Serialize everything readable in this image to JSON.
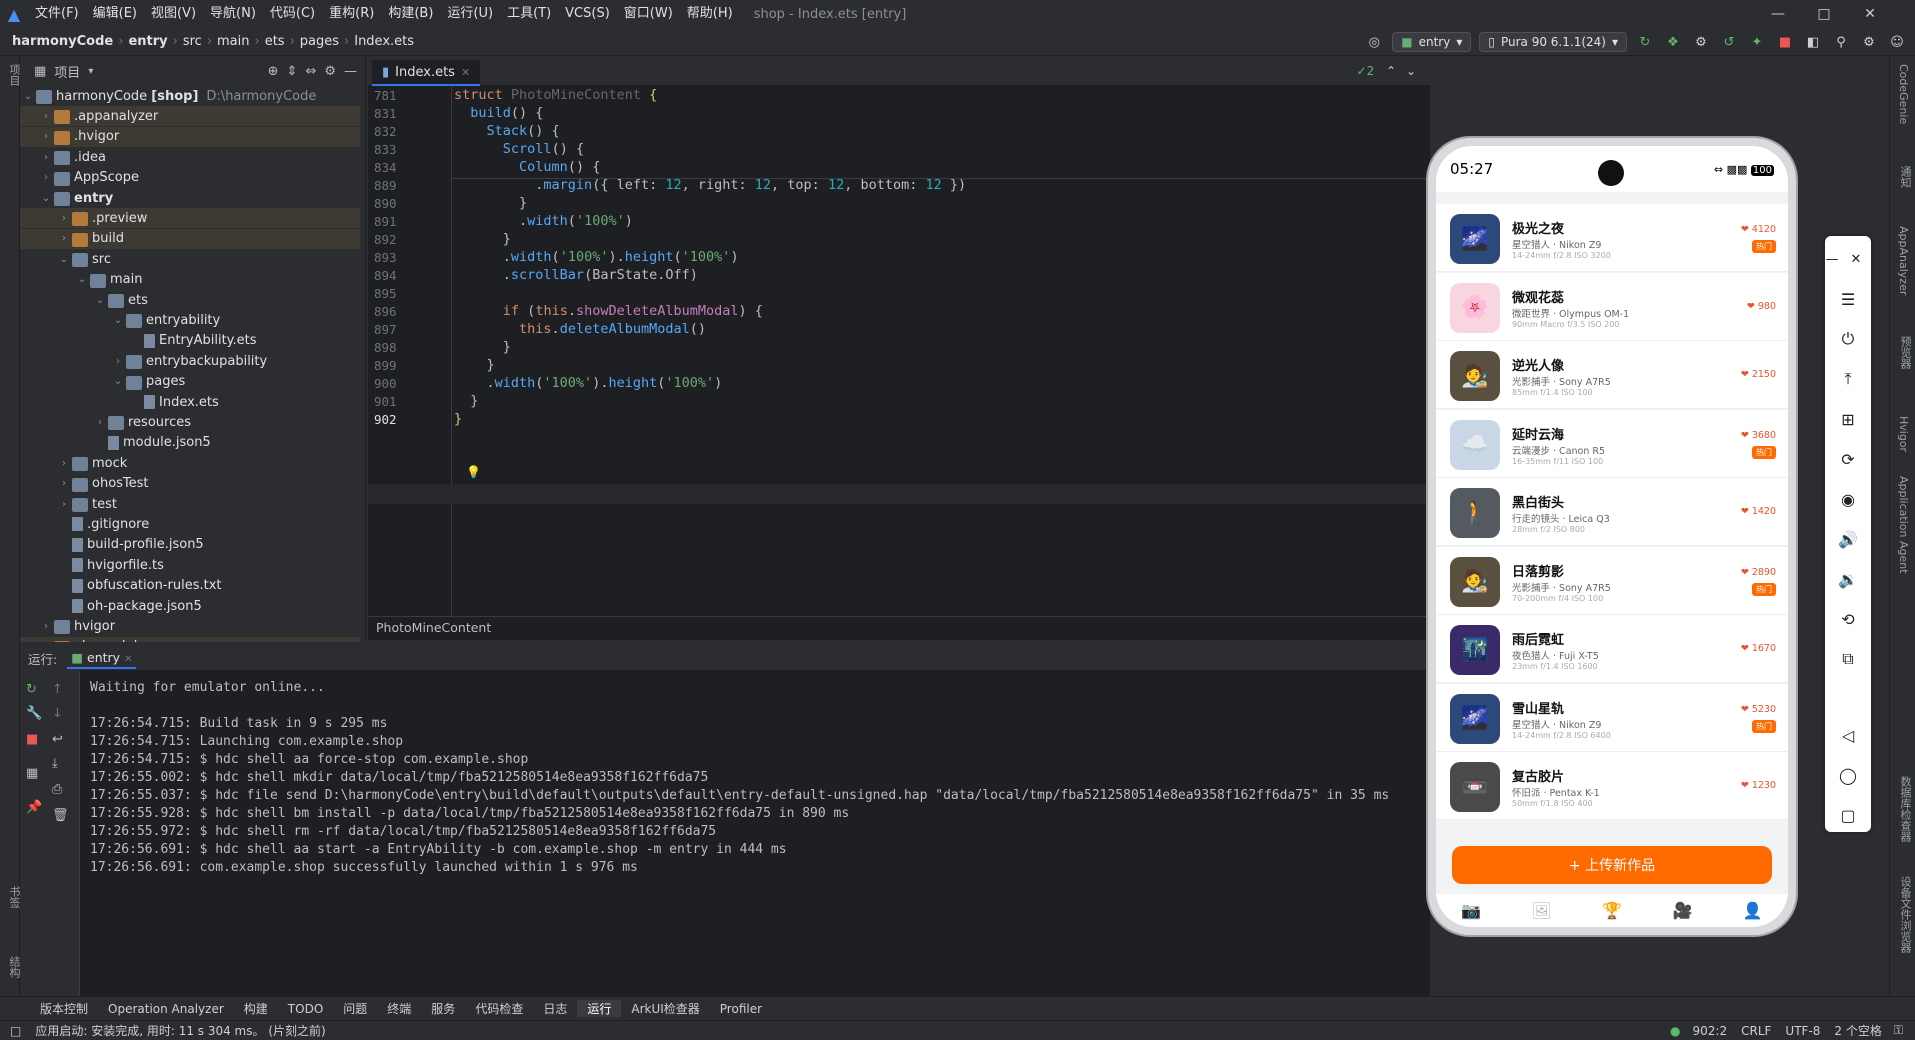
{
  "window": {
    "menu": [
      "文件(F)",
      "编辑(E)",
      "视图(V)",
      "导航(N)",
      "代码(C)",
      "重构(R)",
      "构建(B)",
      "运行(U)",
      "工具(T)",
      "VCS(S)",
      "窗口(W)",
      "帮助(H)"
    ],
    "title": "shop - Index.ets [entry]"
  },
  "navbar": {
    "crumbs": [
      "harmonyCode",
      "entry",
      "src",
      "main",
      "ets",
      "pages",
      "Index.ets"
    ],
    "run_config": "entry",
    "device": "Pura 90 6.1.1(24)"
  },
  "project": {
    "panel_title": "项目",
    "root_name": "harmonyCode",
    "root_module": "[shop]",
    "root_path": "D:\\harmonyCode",
    "tree": [
      {
        "name": ".appanalyzer",
        "depth": 1,
        "type": "folder-orange",
        "expanded": false,
        "hl": true
      },
      {
        "name": ".hvigor",
        "depth": 1,
        "type": "folder-orange",
        "expanded": false,
        "hl": true
      },
      {
        "name": ".idea",
        "depth": 1,
        "type": "folder",
        "expanded": false
      },
      {
        "name": "AppScope",
        "depth": 1,
        "type": "folder",
        "expanded": false
      },
      {
        "name": "entry",
        "depth": 1,
        "type": "folder",
        "expanded": true,
        "bold": true
      },
      {
        "name": ".preview",
        "depth": 2,
        "type": "folder-orange",
        "expanded": false,
        "hl": true
      },
      {
        "name": "build",
        "depth": 2,
        "type": "folder-orange",
        "expanded": false,
        "hl": true
      },
      {
        "name": "src",
        "depth": 2,
        "type": "folder",
        "expanded": true
      },
      {
        "name": "main",
        "depth": 3,
        "type": "folder",
        "expanded": true
      },
      {
        "name": "ets",
        "depth": 4,
        "type": "folder",
        "expanded": true
      },
      {
        "name": "entryability",
        "depth": 5,
        "type": "folder",
        "expanded": true
      },
      {
        "name": "EntryAbility.ets",
        "depth": 6,
        "type": "file"
      },
      {
        "name": "entrybackupability",
        "depth": 5,
        "type": "folder",
        "expanded": false
      },
      {
        "name": "pages",
        "depth": 5,
        "type": "folder",
        "expanded": true
      },
      {
        "name": "Index.ets",
        "depth": 6,
        "type": "file"
      },
      {
        "name": "resources",
        "depth": 4,
        "type": "folder",
        "expanded": false
      },
      {
        "name": "module.json5",
        "depth": 4,
        "type": "file"
      },
      {
        "name": "mock",
        "depth": 2,
        "type": "folder",
        "expanded": false
      },
      {
        "name": "ohosTest",
        "depth": 2,
        "type": "folder",
        "expanded": false
      },
      {
        "name": "test",
        "depth": 2,
        "type": "folder",
        "expanded": false
      },
      {
        "name": ".gitignore",
        "depth": 2,
        "type": "file"
      },
      {
        "name": "build-profile.json5",
        "depth": 2,
        "type": "file"
      },
      {
        "name": "hvigorfile.ts",
        "depth": 2,
        "type": "file"
      },
      {
        "name": "obfuscation-rules.txt",
        "depth": 2,
        "type": "file"
      },
      {
        "name": "oh-package.json5",
        "depth": 2,
        "type": "file"
      },
      {
        "name": "hvigor",
        "depth": 1,
        "type": "folder",
        "expanded": false
      },
      {
        "name": "oh_modules",
        "depth": 1,
        "type": "folder-orange",
        "expanded": false,
        "hl": true
      }
    ]
  },
  "editor": {
    "tab": "Index.ets",
    "breadcrumb": "PhotoMineContent",
    "problems": "2",
    "lines": [
      {
        "n": "781",
        "html": "<span class='kw'>struct</span> <span style='color:#bcbec4;opacity:.45'>PhotoMineContent</span> <span style='color:#e0c46c'>{</span>"
      },
      {
        "n": "831",
        "html": "  <span class='fn'>build</span>() {"
      },
      {
        "n": "832",
        "html": "    <span class='fn'>Stack</span>() {"
      },
      {
        "n": "833",
        "html": "      <span class='fn'>Scroll</span>() {"
      },
      {
        "n": "834",
        "html": "        <span class='fn'>Column</span>() {"
      },
      {
        "n": "889",
        "html": "          .<span class='fn'>margin</span>({ left: <span class='num'>12</span>, right: <span class='num'>12</span>, top: <span class='num'>12</span>, bottom: <span class='num'>12</span> })"
      },
      {
        "n": "890",
        "html": "        }"
      },
      {
        "n": "891",
        "html": "        .<span class='fn'>width</span>(<span class='str'>'100%'</span>)"
      },
      {
        "n": "892",
        "html": "      }"
      },
      {
        "n": "893",
        "html": "      .<span class='fn'>width</span>(<span class='str'>'100%'</span>).<span class='fn'>height</span>(<span class='str'>'100%'</span>)"
      },
      {
        "n": "894",
        "html": "      .<span class='fn'>scrollBar</span>(BarState.Off)"
      },
      {
        "n": "895",
        "html": ""
      },
      {
        "n": "896",
        "html": "      <span class='kw'>if</span> (<span class='kw'>this</span>.<span class='mem'>showDeleteAlbumModal</span>) {"
      },
      {
        "n": "897",
        "html": "        <span class='kw'>this</span>.<span class='fn'>deleteAlbumModal</span>()"
      },
      {
        "n": "898",
        "html": "      }"
      },
      {
        "n": "899",
        "html": "    }"
      },
      {
        "n": "900",
        "html": "    .<span class='fn'>width</span>(<span class='str'>'100%'</span>).<span class='fn'>height</span>(<span class='str'>'100%'</span>)"
      },
      {
        "n": "901",
        "html": "  }"
      },
      {
        "n": "902",
        "html": "<span style='color:#e0c46c'>}</span>"
      }
    ]
  },
  "run": {
    "label": "运行:",
    "tab": "entry",
    "lines": [
      "Waiting for emulator online...",
      "",
      "17:26:54.715: Build task in 9 s 295 ms",
      "17:26:54.715: Launching com.example.shop",
      "17:26:54.715: $ hdc shell aa force-stop com.example.shop",
      "17:26:55.002: $ hdc shell mkdir data/local/tmp/fba5212580514e8ea9358f162ff6da75",
      "17:26:55.037: $ hdc file send D:\\harmonyCode\\entry\\build\\default\\outputs\\default\\entry-default-unsigned.hap \"data/local/tmp/fba5212580514e8ea9358f162ff6da75\" in 35 ms",
      "17:26:55.928: $ hdc shell bm install -p data/local/tmp/fba5212580514e8ea9358f162ff6da75 in 890 ms",
      "17:26:55.972: $ hdc shell rm -rf data/local/tmp/fba5212580514e8ea9358f162ff6da75",
      "17:26:56.691: $ hdc shell aa start -a EntryAbility -b com.example.shop -m entry in 444 ms",
      "17:26:56.691: com.example.shop successfully launched within 1 s 976 ms"
    ]
  },
  "bottom_tools": [
    "版本控制",
    "Operation Analyzer",
    "构建",
    "TODO",
    "问题",
    "终端",
    "服务",
    "代码检查",
    "日志",
    "运行",
    "ArkUI检查器",
    "Profiler"
  ],
  "status": {
    "message": "应用启动: 安装完成, 用时: 11 s 304 ms。 (片刻之前)",
    "position": "902:2",
    "line_ending": "CRLF",
    "encoding": "UTF-8",
    "indent": "2 个空格"
  },
  "left_strip": [
    "项目",
    "书签",
    "结构"
  ],
  "right_strip": [
    "CodeGenie",
    "通知",
    "AppAnalyzer",
    "预览器",
    "Hvigor",
    "Application Agent",
    "数据库检查器",
    "设备文件浏览器"
  ],
  "phone": {
    "time": "05:27",
    "battery": "100",
    "items": [
      {
        "title": "极光之夜",
        "author": "星空猎人 · Nikon Z9",
        "spec": "14-24mm f/2.8 ISO 3200",
        "likes": "4120",
        "hot": "热门",
        "color": "#2b4a7a",
        "emoji": "🌌"
      },
      {
        "title": "微观花蕊",
        "author": "微距世界 · Olympus OM-1",
        "spec": "90mm Macro f/3.5 ISO 200",
        "likes": "980",
        "hot": "",
        "color": "#f7d6e0",
        "emoji": "🌸"
      },
      {
        "title": "逆光人像",
        "author": "光影捕手 · Sony A7R5",
        "spec": "85mm f/1.4 ISO 100",
        "likes": "2150",
        "hot": "",
        "color": "#5a5040",
        "emoji": "🧑‍🎨"
      },
      {
        "title": "延时云海",
        "author": "云端漫步 · Canon R5",
        "spec": "16-35mm f/11 ISO 100",
        "likes": "3680",
        "hot": "热门",
        "color": "#c8d6e6",
        "emoji": "☁️"
      },
      {
        "title": "黑白街头",
        "author": "行走的镜头 · Leica Q3",
        "spec": "28mm f/2 ISO 800",
        "likes": "1420",
        "hot": "",
        "color": "#555a60",
        "emoji": "🚶"
      },
      {
        "title": "日落剪影",
        "author": "光影捕手 · Sony A7R5",
        "spec": "70-200mm f/4 ISO 100",
        "likes": "2890",
        "hot": "热门",
        "color": "#5a5040",
        "emoji": "🧑‍🎨"
      },
      {
        "title": "雨后霓虹",
        "author": "夜色猎人 · Fuji X-T5",
        "spec": "23mm f/1.4 ISO 1600",
        "likes": "1670",
        "hot": "",
        "color": "#3a2a6a",
        "emoji": "🌃"
      },
      {
        "title": "雪山星轨",
        "author": "星空猎人 · Nikon Z9",
        "spec": "14-24mm f/2.8 ISO 6400",
        "likes": "5230",
        "hot": "热门",
        "color": "#2b4a7a",
        "emoji": "🌌"
      },
      {
        "title": "复古胶片",
        "author": "怀旧派 · Pentax K-1",
        "spec": "50mm f/1.8 ISO 400",
        "likes": "1230",
        "hot": "",
        "color": "#4a4a4a",
        "emoji": "📼"
      }
    ],
    "upload": "+ 上传新作品",
    "tabs": [
      "📷",
      "🖼",
      "🏆",
      "🎥",
      "👤"
    ]
  }
}
